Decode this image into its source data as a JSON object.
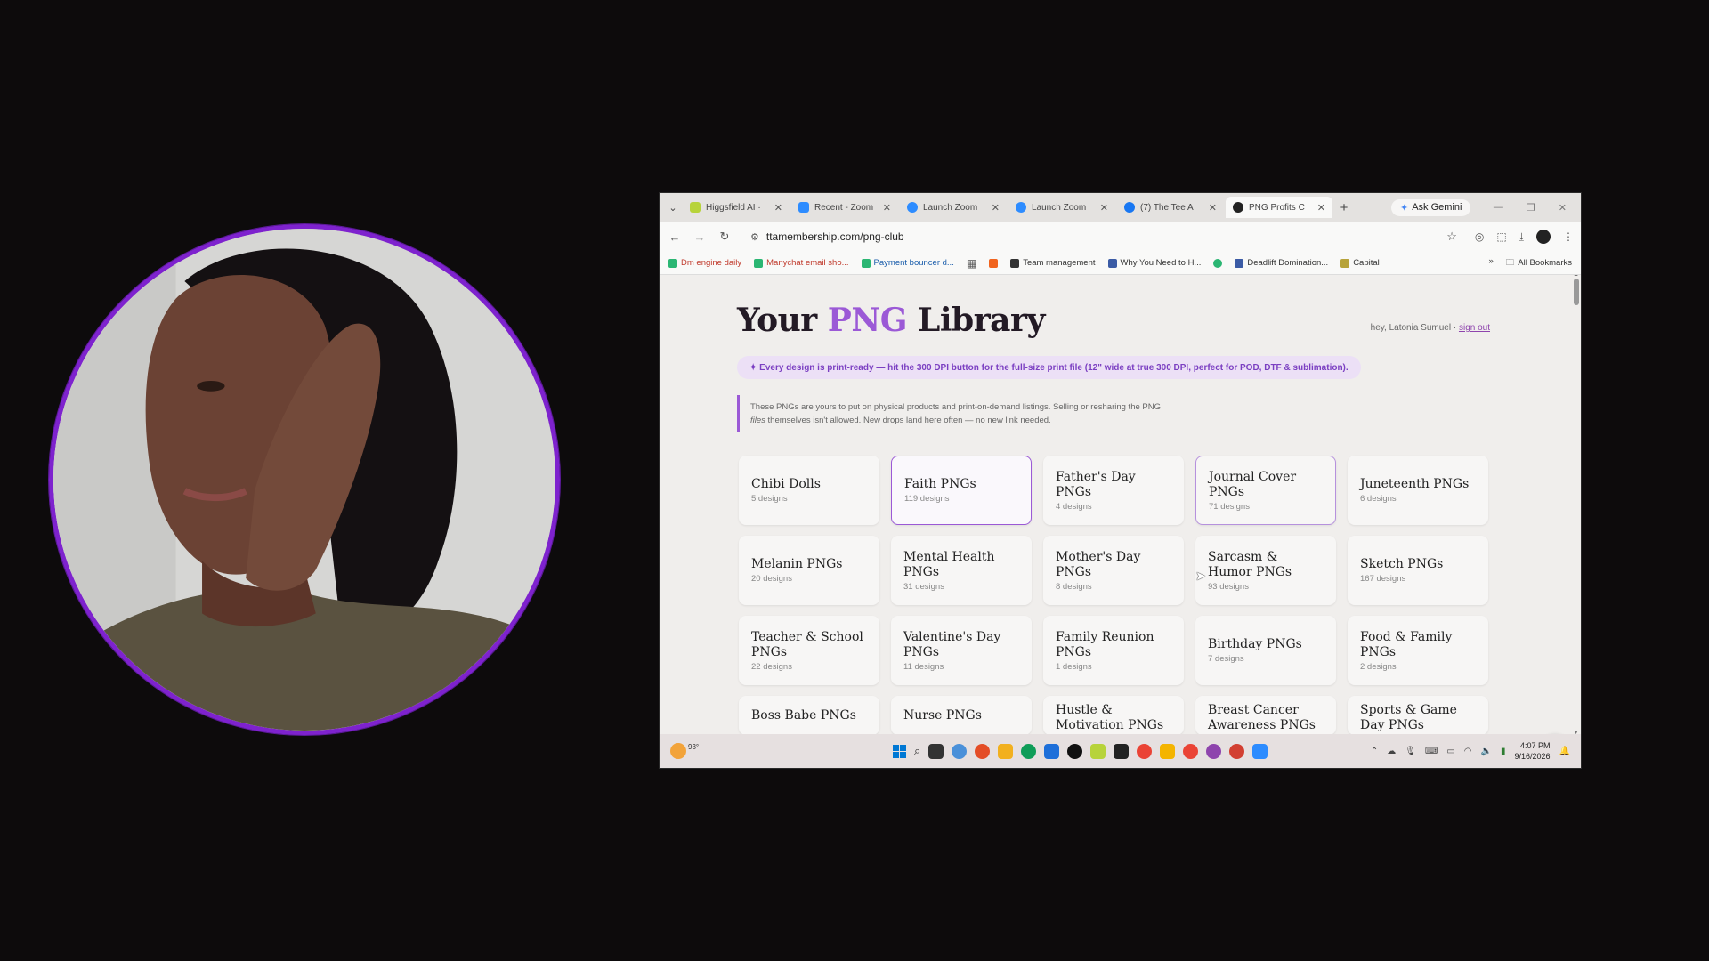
{
  "browser": {
    "tabs": [
      {
        "title": "Higgsfield AI ·",
        "color": "#b7d33a"
      },
      {
        "title": "Recent - Zoom",
        "color": "#2d8cff"
      },
      {
        "title": "Launch Zoom",
        "color": "#2d8cff"
      },
      {
        "title": "Launch Zoom",
        "color": "#2d8cff"
      },
      {
        "title": "(7) The Tee A",
        "color": "#1877f2"
      },
      {
        "title": "PNG Profits C",
        "color": "#222222",
        "active": true
      }
    ],
    "gemini_label": "Ask Gemini",
    "url": "ttamembership.com/png-club",
    "bookmarks": [
      {
        "label": "Dm engine daily",
        "style": "red"
      },
      {
        "label": "Manychat email sho...",
        "style": "red"
      },
      {
        "label": "Payment bouncer d...",
        "style": "blue"
      },
      {
        "label": "Team management",
        "style": "plain"
      },
      {
        "label": "Why You Need to H...",
        "style": "plain"
      },
      {
        "label": "Deadlift Domination...",
        "style": "plain"
      },
      {
        "label": "Capital",
        "style": "plain"
      }
    ],
    "all_bookmarks": "All Bookmarks"
  },
  "page": {
    "title_prefix": "Your ",
    "title_accent": "PNG",
    "title_suffix": " Library",
    "greeting": "hey, Latonia Sumuel · ",
    "sign_out": "sign out",
    "notice": "✦ Every design is print-ready — hit the 300 DPI button for the full-size print file (12\" wide at true 300 DPI, perfect for POD, DTF & sublimation).",
    "rules_line1": "These PNGs are yours to put on physical products and print-on-demand listings. Selling or resharing the PNG",
    "rules_line2_em": "files",
    "rules_line2": " themselves isn't allowed. New drops land here often — no new link needed."
  },
  "categories": [
    {
      "name": "Chibi Dolls",
      "count": "5 designs"
    },
    {
      "name": "Faith PNGs",
      "count": "119 designs",
      "state": "selected"
    },
    {
      "name": "Father's Day PNGs",
      "count": "4 designs"
    },
    {
      "name": "Journal Cover PNGs",
      "count": "71 designs",
      "state": "hover"
    },
    {
      "name": "Juneteenth PNGs",
      "count": "6 designs"
    },
    {
      "name": "Melanin PNGs",
      "count": "20 designs"
    },
    {
      "name": "Mental Health PNGs",
      "count": "31 designs"
    },
    {
      "name": "Mother's Day PNGs",
      "count": "8 designs"
    },
    {
      "name": "Sarcasm & Humor PNGs",
      "count": "93 designs"
    },
    {
      "name": "Sketch PNGs",
      "count": "167 designs"
    },
    {
      "name": "Teacher & School PNGs",
      "count": "22 designs"
    },
    {
      "name": "Valentine's Day PNGs",
      "count": "11 designs"
    },
    {
      "name": "Family Reunion PNGs",
      "count": "1 designs"
    },
    {
      "name": "Birthday PNGs",
      "count": "7 designs"
    },
    {
      "name": "Food & Family PNGs",
      "count": "2 designs"
    },
    {
      "name": "Boss Babe PNGs",
      "count": ""
    },
    {
      "name": "Nurse PNGs",
      "count": ""
    },
    {
      "name": "Hustle & Motivation PNGs",
      "count": ""
    },
    {
      "name": "Breast Cancer Awareness PNGs",
      "count": ""
    },
    {
      "name": "Sports & Game Day PNGs",
      "count": ""
    }
  ],
  "taskbar": {
    "temperature": "93°",
    "time": "4:07 PM",
    "date": "9/16/2026",
    "apps": [
      "#0078d4",
      "#333333",
      "#555555",
      "#4a90d9",
      "#e44d26",
      "#f2b01e",
      "#0f9d58",
      "#1e6fd9",
      "#111111",
      "#b7d33a",
      "#222222",
      "#ea4335",
      "#f4b400",
      "#8e44ad",
      "#d23f31",
      "#2d8cff"
    ]
  },
  "colors": {
    "accent": "#9b59d6",
    "cam_ring": "#7e22ce"
  }
}
